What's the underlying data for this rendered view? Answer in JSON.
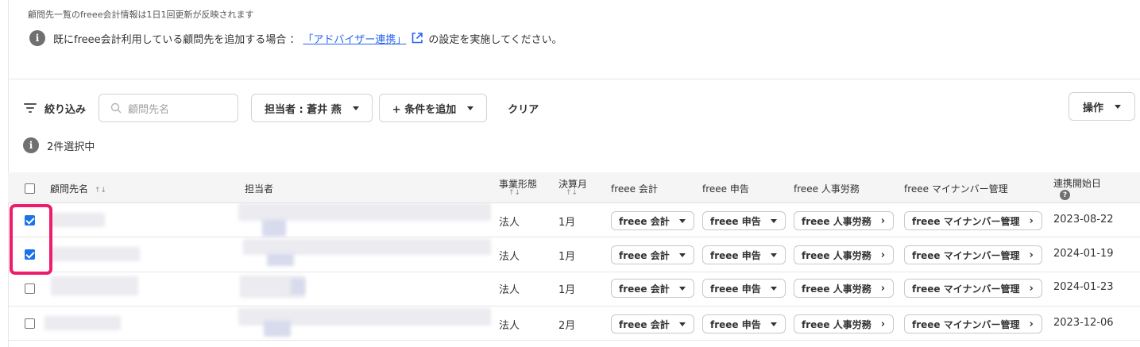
{
  "notice": "顧問先一覧のfreee会計情報は1日1回更新が反映されます",
  "info": {
    "prefix": "既にfreee会計利用している顧問先を追加する場合 ：",
    "link": "「アドバイザー連携」",
    "suffix": "の設定を実施してください。"
  },
  "filter": {
    "label": "絞り込み",
    "search_placeholder": "顧問先名",
    "assignee_button": "担当者 : 蒼井 燕",
    "add_condition_button": "+ 条件を追加",
    "clear_button": "クリア",
    "operations_button": "操作"
  },
  "selection_status": "2件選択中",
  "table": {
    "columns": {
      "name": "顧問先名",
      "assignee": "担当者",
      "business_type": "事業形態",
      "fiscal_month": "決算月",
      "accounting": "freee 会計",
      "tax_filing": "freee 申告",
      "hr": "freee 人事労務",
      "mynumber": "freee マイナンバー管理",
      "start_date": "連携開始日"
    },
    "rows": [
      {
        "checked": true,
        "business_type": "法人",
        "fiscal_month": "1月",
        "accounting": "freee 会計",
        "tax_filing": "freee 申告",
        "hr": "freee 人事労務",
        "mynumber": "freee マイナンバー管理",
        "start_date": "2023-08-22"
      },
      {
        "checked": true,
        "business_type": "法人",
        "fiscal_month": "1月",
        "accounting": "freee 会計",
        "tax_filing": "freee 申告",
        "hr": "freee 人事労務",
        "mynumber": "freee マイナンバー管理",
        "start_date": "2024-01-19"
      },
      {
        "checked": false,
        "business_type": "法人",
        "fiscal_month": "1月",
        "accounting": "freee 会計",
        "tax_filing": "freee 申告",
        "hr": "freee 人事労務",
        "mynumber": "freee マイナンバー管理",
        "start_date": "2024-01-23"
      },
      {
        "checked": false,
        "business_type": "法人",
        "fiscal_month": "2月",
        "accounting": "freee 会計",
        "tax_filing": "freee 申告",
        "hr": "freee 人事労務",
        "mynumber": "freee マイナンバー管理",
        "start_date": "2023-12-06"
      }
    ]
  },
  "colors": {
    "accent": "#2864f0",
    "checkbox": "#1a73e8",
    "highlight": "#ee1c6c"
  }
}
